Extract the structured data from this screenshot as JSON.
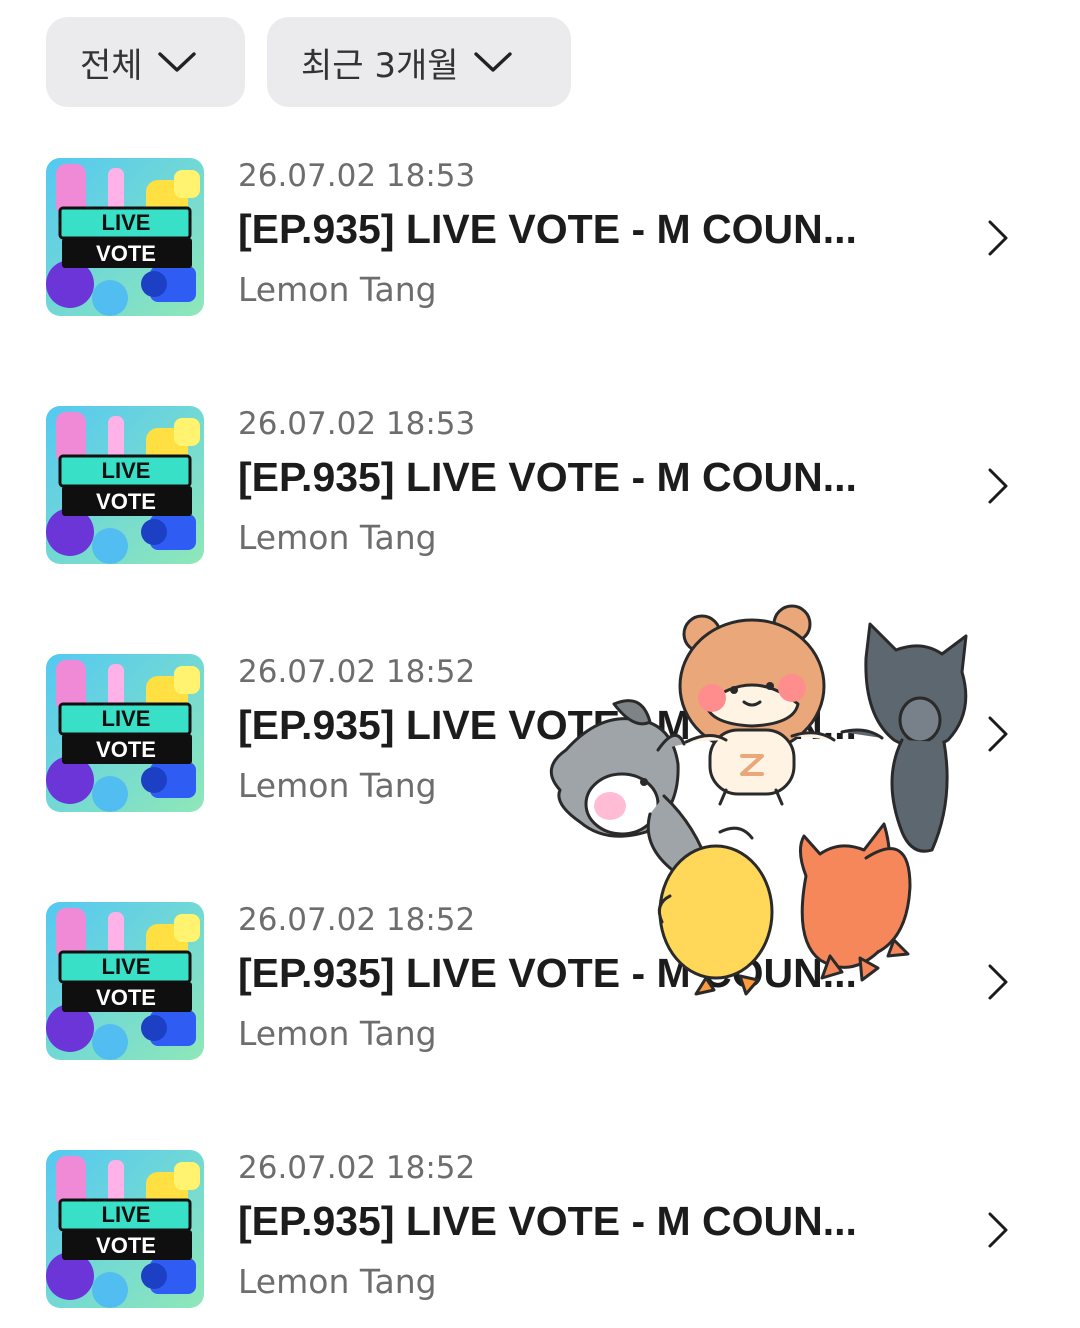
{
  "filters": [
    {
      "label": "전체"
    },
    {
      "label": "최근 3개월"
    }
  ],
  "thumbnail": {
    "line1": "LIVE",
    "line2": "VOTE"
  },
  "items": [
    {
      "date": "26.07.02 18:53",
      "title": "[EP.935] LIVE VOTE - M COUN...",
      "author": "Lemon Tang"
    },
    {
      "date": "26.07.02 18:53",
      "title": "[EP.935] LIVE VOTE - M COUN...",
      "author": "Lemon Tang"
    },
    {
      "date": "26.07.02 18:52",
      "title": "[EP.935] LIVE VOTE - M COUN...",
      "author": "Lemon Tang"
    },
    {
      "date": "26.07.02 18:52",
      "title": "[EP.935] LIVE VOTE - M COUN...",
      "author": "Lemon Tang"
    },
    {
      "date": "26.07.02 18:52",
      "title": "[EP.935] LIVE VOTE - M COUN...",
      "author": "Lemon Tang"
    }
  ],
  "colors": {
    "filter_bg": "#ebebed",
    "meta_text": "#6d6d6d",
    "title_text": "#1c1c1c"
  },
  "icons": {
    "filter_chevron": "chevron-down-icon",
    "row_arrow": "chevron-right-icon",
    "sticker": "animal-friends-sticker"
  }
}
